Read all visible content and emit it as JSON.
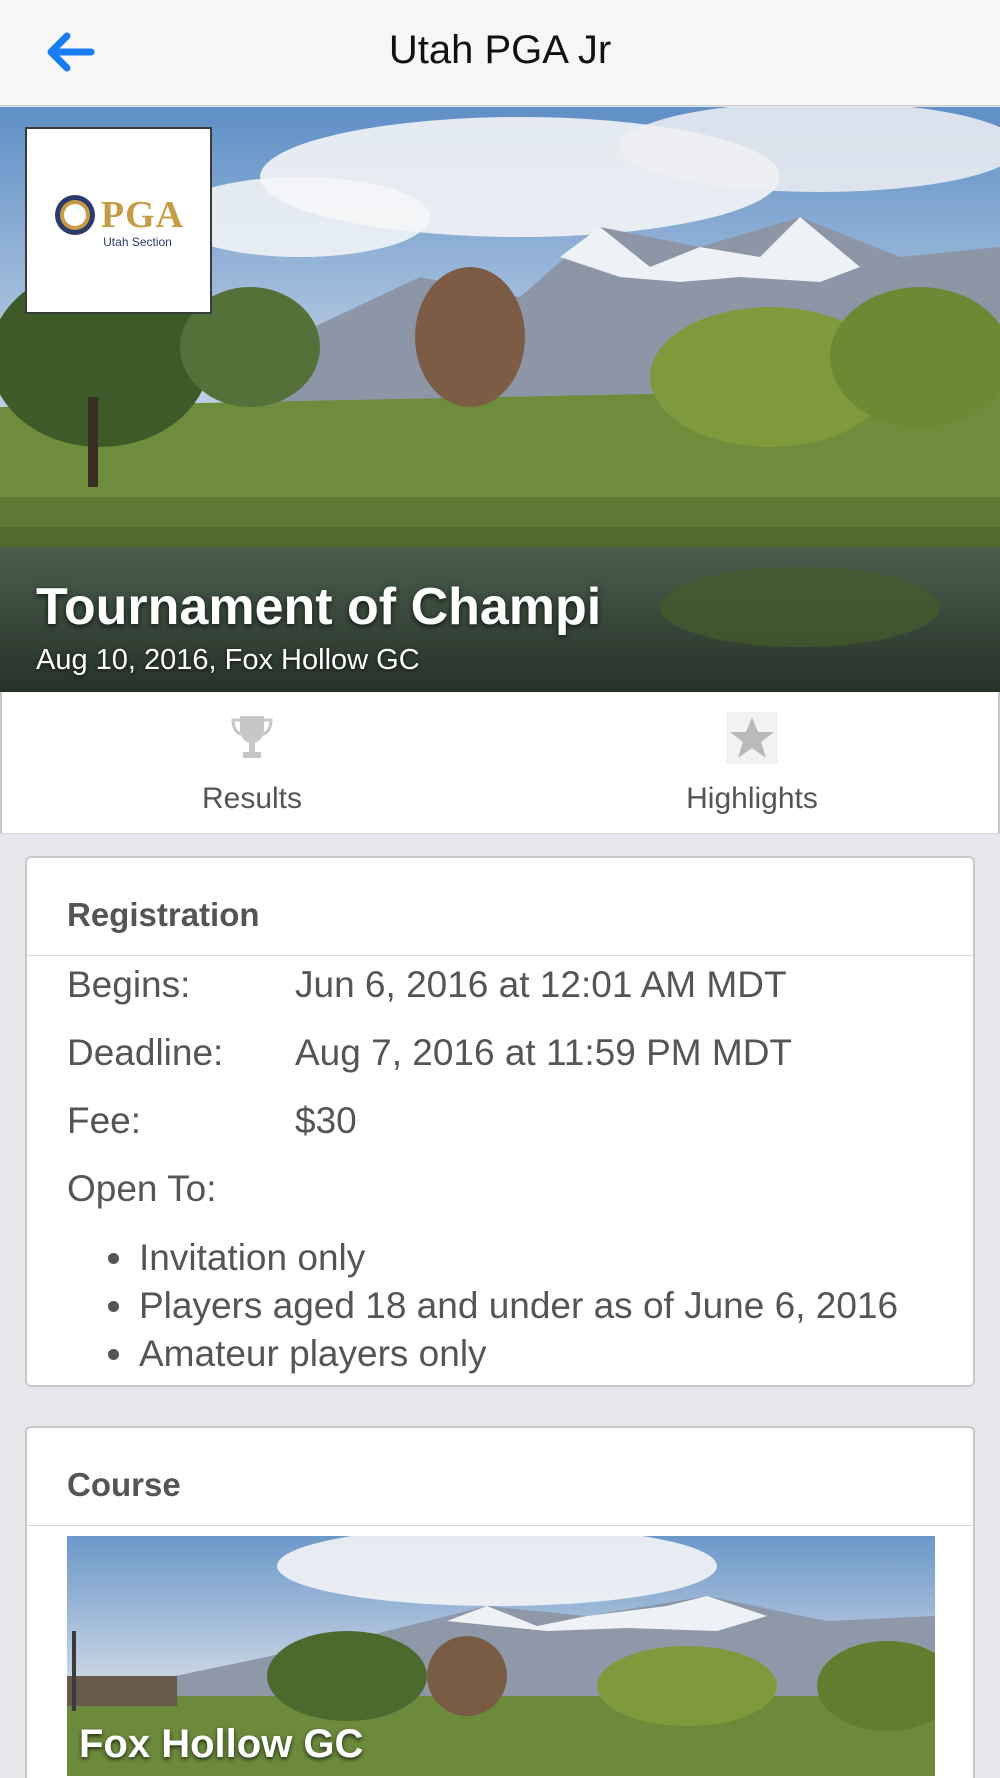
{
  "nav": {
    "title": "Utah PGA Jr",
    "back_icon": "arrow-left-icon",
    "accent": "#1a7cf5"
  },
  "hero": {
    "logo_text": "PGA",
    "logo_sub": "Utah Section",
    "title": "Tournament of Champi",
    "subtitle": "Aug 10, 2016, Fox Hollow GC"
  },
  "tabs": [
    {
      "label": "Results",
      "icon": "trophy-icon"
    },
    {
      "label": "Highlights",
      "icon": "star-icon"
    }
  ],
  "registration": {
    "heading": "Registration",
    "rows": [
      {
        "key": "Begins:",
        "value": "Jun 6, 2016 at 12:01 AM MDT"
      },
      {
        "key": "Deadline:",
        "value": "Aug 7, 2016 at 11:59 PM MDT"
      },
      {
        "key": "Fee:",
        "value": "$30"
      }
    ],
    "open_to_label": "Open To:",
    "open_to": [
      "Invitation only",
      "Players aged 18 and under as of June 6, 2016",
      "Amateur players only"
    ]
  },
  "course": {
    "heading": "Course",
    "name": "Fox Hollow GC"
  }
}
